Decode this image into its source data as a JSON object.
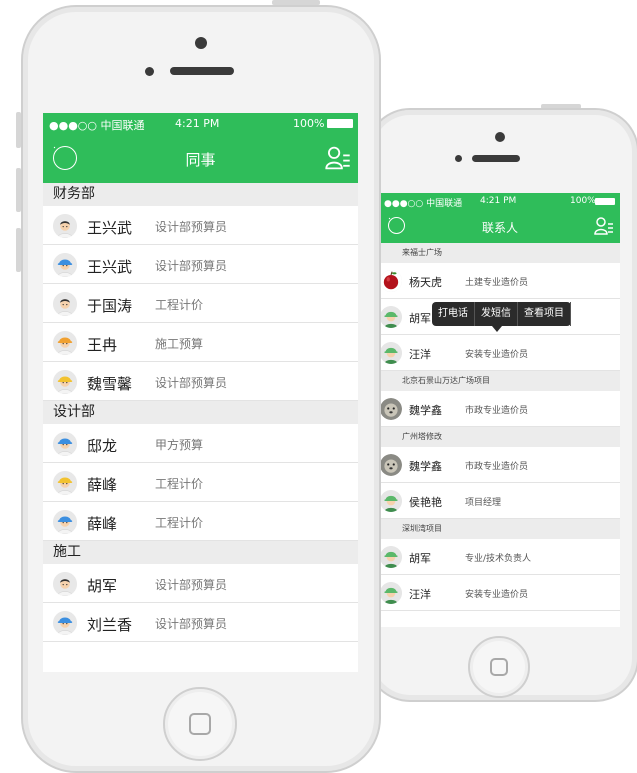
{
  "front": {
    "status": {
      "carrier": "●●●○○ 中国联通",
      "time": "4:21 PM",
      "battery": "100%"
    },
    "nav": {
      "title": "同事"
    },
    "sections": [
      {
        "title": "财务部",
        "rows": [
          {
            "name": "王兴武",
            "role": "设计部预算员",
            "hat": "none"
          },
          {
            "name": "王兴武",
            "role": "设计部预算员",
            "hat": "blue"
          },
          {
            "name": "于国涛",
            "role": "工程计价",
            "hat": "none"
          },
          {
            "name": "王冉",
            "role": "施工预算",
            "hat": "orange"
          },
          {
            "name": "魏雪馨",
            "role": "设计部预算员",
            "hat": "yellow"
          }
        ]
      },
      {
        "title": "设计部",
        "rows": [
          {
            "name": "邸龙",
            "role": "甲方预算",
            "hat": "blue"
          },
          {
            "name": "薛峰",
            "role": "工程计价",
            "hat": "yellow"
          },
          {
            "name": "薛峰",
            "role": "工程计价",
            "hat": "blue"
          }
        ]
      },
      {
        "title": "施工",
        "rows": [
          {
            "name": "胡军",
            "role": "设计部预算员",
            "hat": "none"
          },
          {
            "name": "刘兰香",
            "role": "设计部预算员",
            "hat": "blue"
          }
        ]
      }
    ]
  },
  "back": {
    "status": {
      "carrier": "●●●○○ 中国联通",
      "time": "4:21 PM",
      "battery": "100%"
    },
    "nav": {
      "title": "联系人"
    },
    "popup": {
      "options": [
        "打电话",
        "发短信",
        "查看项目"
      ]
    },
    "sections": [
      {
        "title": "来福士广场",
        "rows": [
          {
            "name": "杨天虎",
            "role": "土建专业造价员",
            "avatar": "apple"
          },
          {
            "name": "胡军",
            "role": "",
            "avatar": "worker"
          },
          {
            "name": "汪洋",
            "role": "安装专业造价员",
            "avatar": "worker"
          }
        ]
      },
      {
        "title": "北京石景山万达广场项目",
        "rows": [
          {
            "name": "魏学鑫",
            "role": "市政专业造价员",
            "avatar": "animal"
          }
        ]
      },
      {
        "title": "广州塔修改",
        "rows": [
          {
            "name": "魏学鑫",
            "role": "市政专业造价员",
            "avatar": "animal"
          },
          {
            "name": "侯艳艳",
            "role": "项目经理",
            "avatar": "worker"
          }
        ]
      },
      {
        "title": "深圳湾项目",
        "rows": [
          {
            "name": "胡军",
            "role": "专业/技术负责人",
            "avatar": "worker"
          },
          {
            "name": "汪洋",
            "role": "安装专业造价员",
            "avatar": "worker"
          }
        ]
      }
    ]
  },
  "colors": {
    "accent": "#2fbd5a",
    "section_bg": "#ececec"
  }
}
